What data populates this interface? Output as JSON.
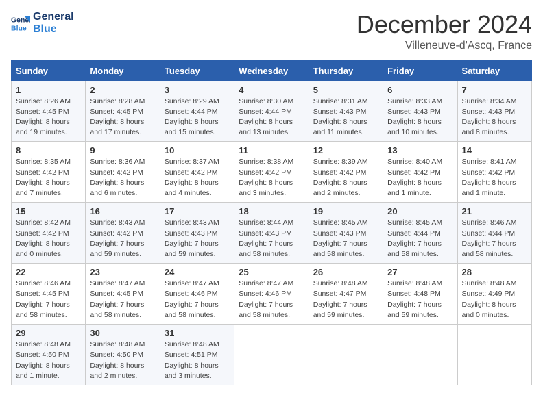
{
  "header": {
    "logo_line1": "General",
    "logo_line2": "Blue",
    "month": "December 2024",
    "location": "Villeneuve-d'Ascq, France"
  },
  "days_of_week": [
    "Sunday",
    "Monday",
    "Tuesday",
    "Wednesday",
    "Thursday",
    "Friday",
    "Saturday"
  ],
  "weeks": [
    [
      {
        "day": "1",
        "info": "Sunrise: 8:26 AM\nSunset: 4:45 PM\nDaylight: 8 hours and 19 minutes."
      },
      {
        "day": "2",
        "info": "Sunrise: 8:28 AM\nSunset: 4:45 PM\nDaylight: 8 hours and 17 minutes."
      },
      {
        "day": "3",
        "info": "Sunrise: 8:29 AM\nSunset: 4:44 PM\nDaylight: 8 hours and 15 minutes."
      },
      {
        "day": "4",
        "info": "Sunrise: 8:30 AM\nSunset: 4:44 PM\nDaylight: 8 hours and 13 minutes."
      },
      {
        "day": "5",
        "info": "Sunrise: 8:31 AM\nSunset: 4:43 PM\nDaylight: 8 hours and 11 minutes."
      },
      {
        "day": "6",
        "info": "Sunrise: 8:33 AM\nSunset: 4:43 PM\nDaylight: 8 hours and 10 minutes."
      },
      {
        "day": "7",
        "info": "Sunrise: 8:34 AM\nSunset: 4:43 PM\nDaylight: 8 hours and 8 minutes."
      }
    ],
    [
      {
        "day": "8",
        "info": "Sunrise: 8:35 AM\nSunset: 4:42 PM\nDaylight: 8 hours and 7 minutes."
      },
      {
        "day": "9",
        "info": "Sunrise: 8:36 AM\nSunset: 4:42 PM\nDaylight: 8 hours and 6 minutes."
      },
      {
        "day": "10",
        "info": "Sunrise: 8:37 AM\nSunset: 4:42 PM\nDaylight: 8 hours and 4 minutes."
      },
      {
        "day": "11",
        "info": "Sunrise: 8:38 AM\nSunset: 4:42 PM\nDaylight: 8 hours and 3 minutes."
      },
      {
        "day": "12",
        "info": "Sunrise: 8:39 AM\nSunset: 4:42 PM\nDaylight: 8 hours and 2 minutes."
      },
      {
        "day": "13",
        "info": "Sunrise: 8:40 AM\nSunset: 4:42 PM\nDaylight: 8 hours and 1 minute."
      },
      {
        "day": "14",
        "info": "Sunrise: 8:41 AM\nSunset: 4:42 PM\nDaylight: 8 hours and 1 minute."
      }
    ],
    [
      {
        "day": "15",
        "info": "Sunrise: 8:42 AM\nSunset: 4:42 PM\nDaylight: 8 hours and 0 minutes."
      },
      {
        "day": "16",
        "info": "Sunrise: 8:43 AM\nSunset: 4:42 PM\nDaylight: 7 hours and 59 minutes."
      },
      {
        "day": "17",
        "info": "Sunrise: 8:43 AM\nSunset: 4:43 PM\nDaylight: 7 hours and 59 minutes."
      },
      {
        "day": "18",
        "info": "Sunrise: 8:44 AM\nSunset: 4:43 PM\nDaylight: 7 hours and 58 minutes."
      },
      {
        "day": "19",
        "info": "Sunrise: 8:45 AM\nSunset: 4:43 PM\nDaylight: 7 hours and 58 minutes."
      },
      {
        "day": "20",
        "info": "Sunrise: 8:45 AM\nSunset: 4:44 PM\nDaylight: 7 hours and 58 minutes."
      },
      {
        "day": "21",
        "info": "Sunrise: 8:46 AM\nSunset: 4:44 PM\nDaylight: 7 hours and 58 minutes."
      }
    ],
    [
      {
        "day": "22",
        "info": "Sunrise: 8:46 AM\nSunset: 4:45 PM\nDaylight: 7 hours and 58 minutes."
      },
      {
        "day": "23",
        "info": "Sunrise: 8:47 AM\nSunset: 4:45 PM\nDaylight: 7 hours and 58 minutes."
      },
      {
        "day": "24",
        "info": "Sunrise: 8:47 AM\nSunset: 4:46 PM\nDaylight: 7 hours and 58 minutes."
      },
      {
        "day": "25",
        "info": "Sunrise: 8:47 AM\nSunset: 4:46 PM\nDaylight: 7 hours and 58 minutes."
      },
      {
        "day": "26",
        "info": "Sunrise: 8:48 AM\nSunset: 4:47 PM\nDaylight: 7 hours and 59 minutes."
      },
      {
        "day": "27",
        "info": "Sunrise: 8:48 AM\nSunset: 4:48 PM\nDaylight: 7 hours and 59 minutes."
      },
      {
        "day": "28",
        "info": "Sunrise: 8:48 AM\nSunset: 4:49 PM\nDaylight: 8 hours and 0 minutes."
      }
    ],
    [
      {
        "day": "29",
        "info": "Sunrise: 8:48 AM\nSunset: 4:50 PM\nDaylight: 8 hours and 1 minute."
      },
      {
        "day": "30",
        "info": "Sunrise: 8:48 AM\nSunset: 4:50 PM\nDaylight: 8 hours and 2 minutes."
      },
      {
        "day": "31",
        "info": "Sunrise: 8:48 AM\nSunset: 4:51 PM\nDaylight: 8 hours and 3 minutes."
      },
      null,
      null,
      null,
      null
    ]
  ]
}
